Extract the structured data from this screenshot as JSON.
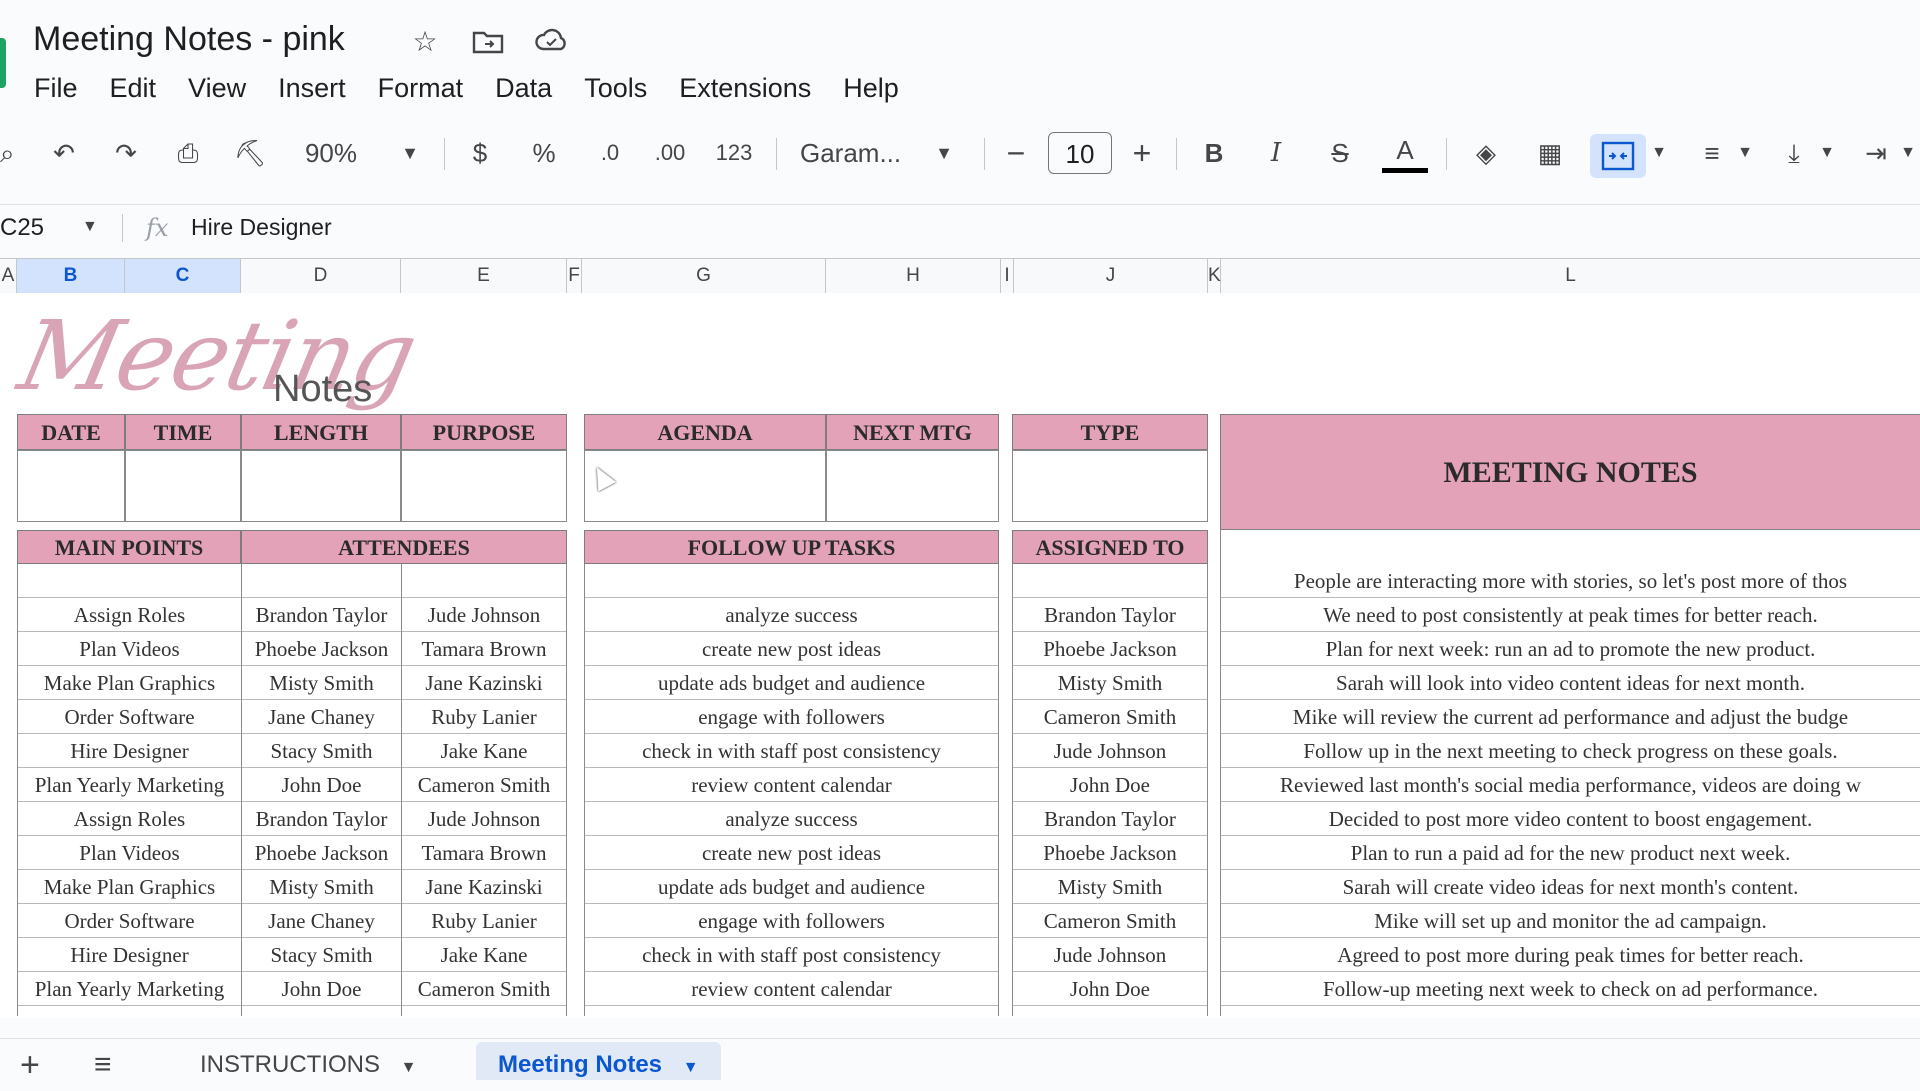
{
  "title": "Meeting Notes - pink",
  "title_icons": [
    "star-icon",
    "move-folder-icon",
    "cloud-status-icon"
  ],
  "menu": [
    "File",
    "Edit",
    "View",
    "Insert",
    "Format",
    "Data",
    "Tools",
    "Extensions",
    "Help"
  ],
  "toolbar": {
    "zoom": "90%",
    "currency": "$",
    "percent": "%",
    "dec_decrease": ".0",
    "dec_increase": ".00",
    "number_format": "123",
    "font": "Garam...",
    "font_size": "10",
    "bold": "B",
    "italic": "I",
    "text_color_letter": "A"
  },
  "formula_bar": {
    "cell_ref": "C25",
    "fx": "fx",
    "value": "Hire Designer"
  },
  "columns": [
    "A",
    "B",
    "C",
    "D",
    "E",
    "F",
    "G",
    "H",
    "I",
    "J",
    "K",
    "L"
  ],
  "logo": {
    "script": "Meeting",
    "word": "Notes"
  },
  "headers": {
    "date": "DATE",
    "time": "TIME",
    "length": "LENGTH",
    "purpose": "PURPOSE",
    "agenda": "AGENDA",
    "next_mtg": "NEXT MTG",
    "type": "TYPE",
    "meeting_notes": "MEETING NOTES",
    "main_points": "MAIN POINTS",
    "attendees": "ATTENDEES",
    "follow_up": "FOLLOW UP TASKS",
    "assigned_to": "ASSIGNED TO"
  },
  "top_note": "People are interacting more with stories, so let's post more of thos",
  "rows": [
    {
      "main": "Assign Roles",
      "a1": "Brandon Taylor",
      "a2": "Jude Johnson",
      "task": "analyze success",
      "assigned": "Brandon Taylor",
      "note": "We need to post consistently at peak times for better reach."
    },
    {
      "main": "Plan Videos",
      "a1": "Phoebe Jackson",
      "a2": "Tamara Brown",
      "task": "create new post ideas",
      "assigned": "Phoebe Jackson",
      "note": "Plan for next week: run an ad to promote the new product."
    },
    {
      "main": "Make Plan Graphics",
      "a1": "Misty Smith",
      "a2": "Jane Kazinski",
      "task": "update ads budget and audience",
      "assigned": "Misty Smith",
      "note": "Sarah will look into video content ideas for next month."
    },
    {
      "main": "Order Software",
      "a1": "Jane Chaney",
      "a2": "Ruby Lanier",
      "task": "engage with followers",
      "assigned": "Cameron Smith",
      "note": "Mike will review the current ad performance and adjust the budge"
    },
    {
      "main": "Hire Designer",
      "a1": "Stacy Smith",
      "a2": "Jake Kane",
      "task": "check in with staff post consistency",
      "assigned": "Jude Johnson",
      "note": "Follow up in the next meeting to check progress on these goals."
    },
    {
      "main": "Plan Yearly Marketing",
      "a1": "John Doe",
      "a2": "Cameron Smith",
      "task": "review content calendar",
      "assigned": "John Doe",
      "note": "Reviewed last month's social media performance, videos are doing w"
    },
    {
      "main": "Assign Roles",
      "a1": "Brandon Taylor",
      "a2": "Jude Johnson",
      "task": "analyze success",
      "assigned": "Brandon Taylor",
      "note": "Decided to post more video content to boost engagement."
    },
    {
      "main": "Plan Videos",
      "a1": "Phoebe Jackson",
      "a2": "Tamara Brown",
      "task": "create new post ideas",
      "assigned": "Phoebe Jackson",
      "note": "Plan to run a paid ad for the new product next week."
    },
    {
      "main": "Make Plan Graphics",
      "a1": "Misty Smith",
      "a2": "Jane Kazinski",
      "task": "update ads budget and audience",
      "assigned": "Misty Smith",
      "note": "Sarah will create video ideas for next month's content."
    },
    {
      "main": "Order Software",
      "a1": "Jane Chaney",
      "a2": "Ruby Lanier",
      "task": "engage with followers",
      "assigned": "Cameron Smith",
      "note": "Mike will set up and monitor the ad campaign."
    },
    {
      "main": "Hire Designer",
      "a1": "Stacy Smith",
      "a2": "Jake Kane",
      "task": "check in with staff post consistency",
      "assigned": "Jude Johnson",
      "note": "Agreed to post more during peak times for better reach."
    },
    {
      "main": "Plan Yearly Marketing",
      "a1": "John Doe",
      "a2": "Cameron Smith",
      "task": "review content calendar",
      "assigned": "John Doe",
      "note": "Follow-up meeting next week to check on ad performance."
    }
  ],
  "sheet_tabs": [
    "INSTRUCTIONS",
    "Meeting Notes"
  ],
  "colors": {
    "header_pink": "#e3a2b7",
    "accent_blue": "#0b57d0",
    "sheets_green": "#1ea362"
  }
}
